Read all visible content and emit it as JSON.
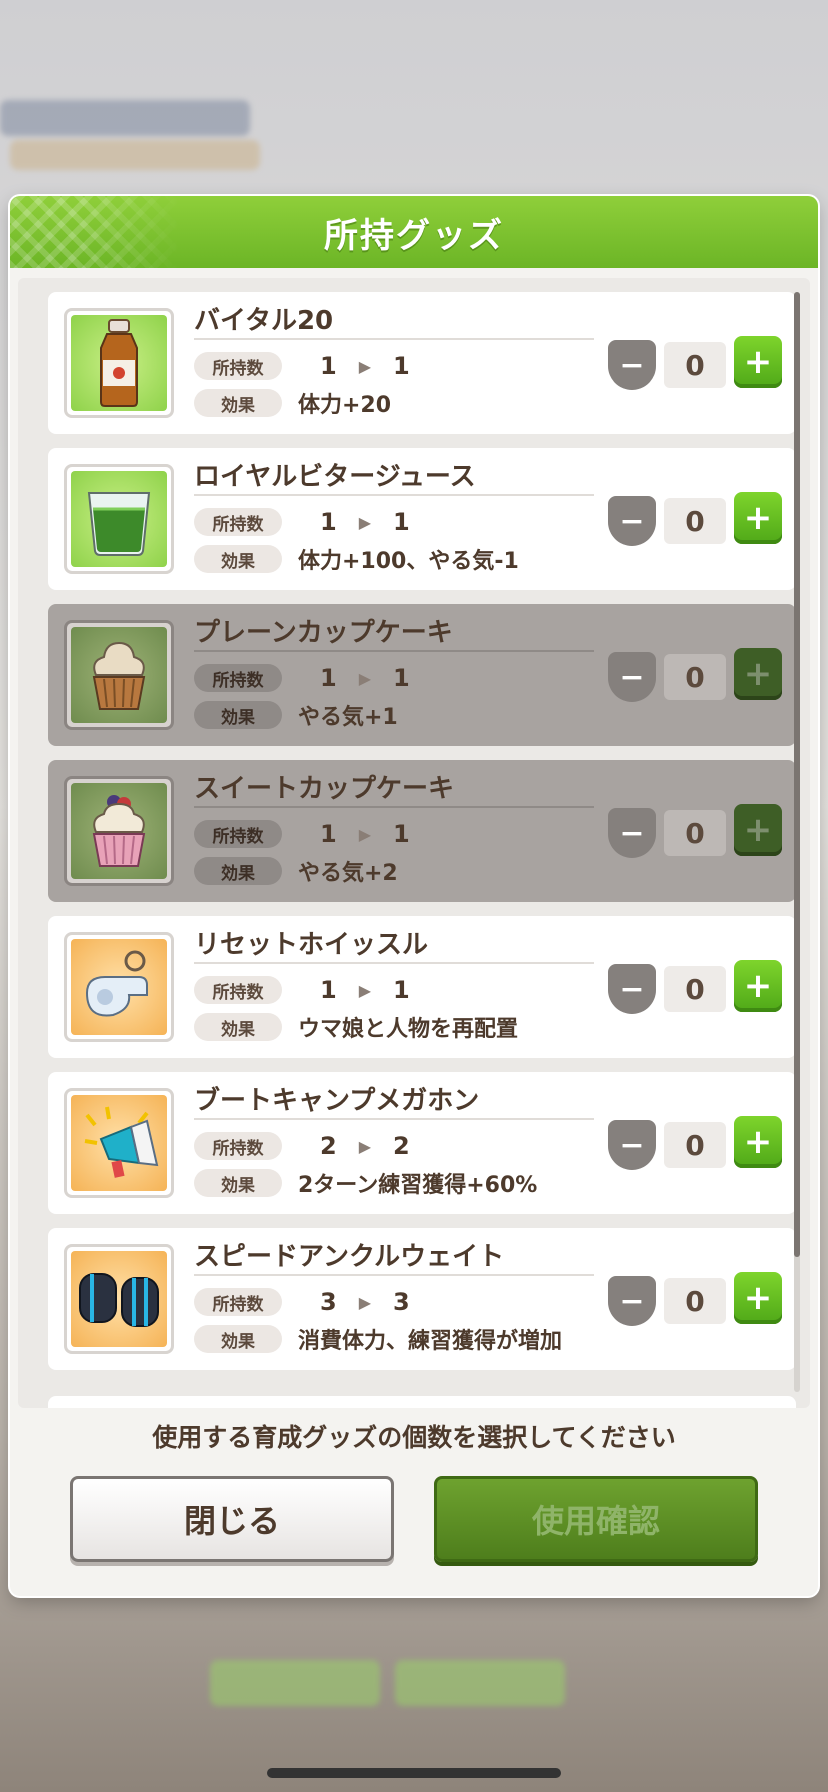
{
  "modal": {
    "title": "所持グッズ"
  },
  "labels": {
    "owned": "所持数",
    "effect": "効果"
  },
  "items": [
    {
      "name": "バイタル20",
      "owned_from": "1",
      "owned_to": "1",
      "effect": "体力+20",
      "qty": "0",
      "icon": "drink-bottle-icon",
      "disabled": false
    },
    {
      "name": "ロイヤルビタージュース",
      "owned_from": "1",
      "owned_to": "1",
      "effect": "体力+100、やる気-1",
      "qty": "0",
      "icon": "green-juice-glass-icon",
      "disabled": false
    },
    {
      "name": "プレーンカップケーキ",
      "owned_from": "1",
      "owned_to": "1",
      "effect": "やる気+1",
      "qty": "0",
      "icon": "plain-cupcake-icon",
      "disabled": true
    },
    {
      "name": "スイートカップケーキ",
      "owned_from": "1",
      "owned_to": "1",
      "effect": "やる気+2",
      "qty": "0",
      "icon": "sweet-cupcake-icon",
      "disabled": true
    },
    {
      "name": "リセットホイッスル",
      "owned_from": "1",
      "owned_to": "1",
      "effect": "ウマ娘と人物を再配置",
      "qty": "0",
      "icon": "whistle-icon",
      "disabled": false
    },
    {
      "name": "ブートキャンプメガホン",
      "owned_from": "2",
      "owned_to": "2",
      "effect": "2ターン練習獲得+60%",
      "qty": "0",
      "icon": "megaphone-icon",
      "disabled": false
    },
    {
      "name": "スピードアンクルウェイト",
      "owned_from": "3",
      "owned_to": "3",
      "effect": "消費体力、練習獲得が増加",
      "qty": "0",
      "icon": "ankle-weight-icon",
      "disabled": false
    }
  ],
  "footer": {
    "instruction": "使用する育成グッズの個数を選択してください",
    "close_label": "閉じる",
    "confirm_label": "使用確認"
  },
  "colors": {
    "accent_green": "#6cb526",
    "text_brown": "#4d3a2c"
  }
}
